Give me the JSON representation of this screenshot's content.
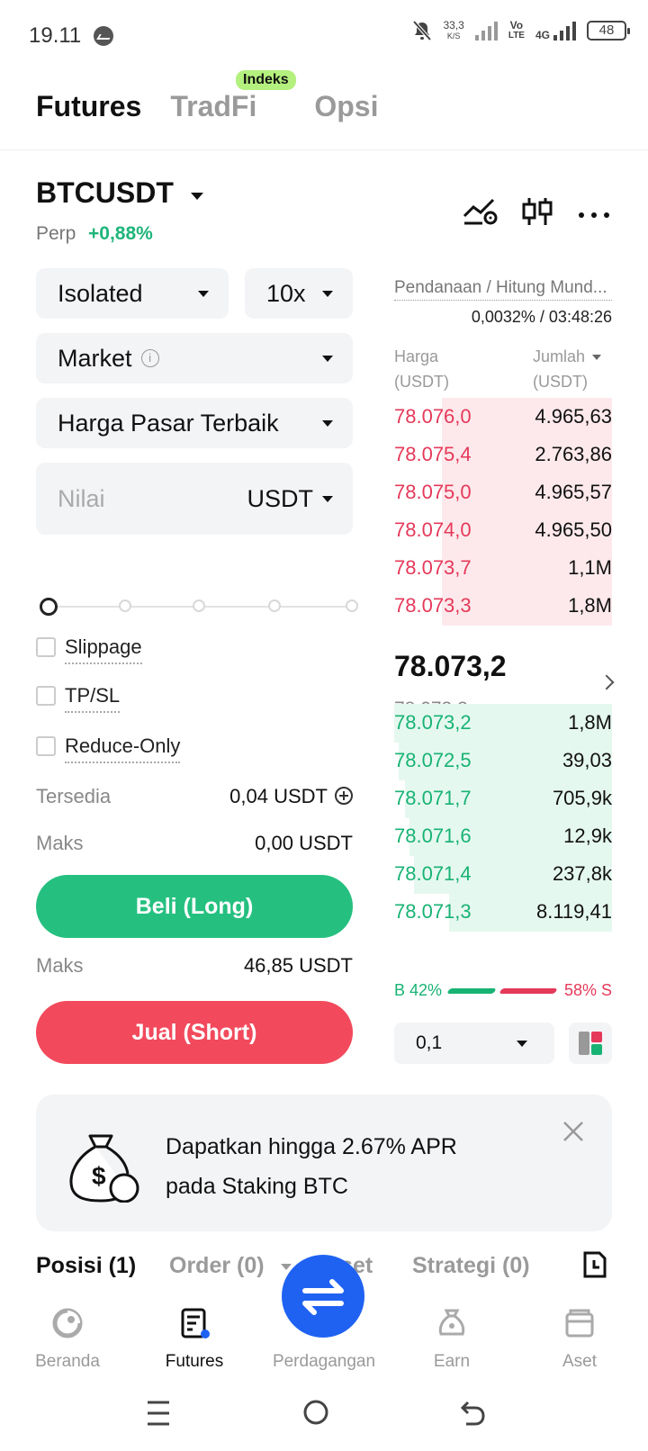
{
  "status_bar": {
    "time": "19.11",
    "speed_value": "33,3",
    "speed_unit": "K/S",
    "lte_top": "Vo",
    "lte_bottom": "LTE",
    "net": "4G",
    "battery": "48"
  },
  "top_tabs": [
    {
      "label": "Futures",
      "active": true
    },
    {
      "label": "TradFi",
      "active": false
    },
    {
      "label": "Opsi",
      "active": false
    }
  ],
  "indeks_badge": "Indeks",
  "pair": {
    "symbol": "BTCUSDT",
    "type": "Perp",
    "change": "+0,88%"
  },
  "form": {
    "margin_mode": "Isolated",
    "leverage": "10x",
    "order_type": "Market",
    "price_mode": "Harga Pasar Terbaik",
    "value_placeholder": "Nilai",
    "value_unit": "USDT",
    "slider_percent": 0,
    "checkboxes": [
      {
        "label": "Slippage",
        "checked": false
      },
      {
        "label": "TP/SL",
        "checked": false
      },
      {
        "label": "Reduce-Only",
        "checked": false
      }
    ],
    "available_label": "Tersedia",
    "available_value": "0,04 USDT",
    "max_buy_label": "Maks",
    "max_buy_value": "0,00 USDT",
    "buy_label": "Beli (Long)",
    "max_sell_label": "Maks",
    "max_sell_value": "46,85 USDT",
    "sell_label": "Jual (Short)"
  },
  "orderbook": {
    "funding_label": "Pendanaan / Hitung Mund...",
    "funding_value": "0,0032% / 03:48:26",
    "price_header": "Harga",
    "price_unit": "(USDT)",
    "qty_header": "Jumlah",
    "qty_unit": "(USDT)",
    "asks": [
      {
        "price": "78.076,0",
        "qty": "4.965,63",
        "depth": 0.78
      },
      {
        "price": "78.075,4",
        "qty": "2.763,86",
        "depth": 0.78
      },
      {
        "price": "78.075,0",
        "qty": "4.965,57",
        "depth": 0.78
      },
      {
        "price": "78.074,0",
        "qty": "4.965,50",
        "depth": 0.78
      },
      {
        "price": "78.073,7",
        "qty": "1,1M",
        "depth": 0.78
      },
      {
        "price": "78.073,3",
        "qty": "1,8M",
        "depth": 0.78
      }
    ],
    "last_price": "78.073,2",
    "mark_price": "78.073,2",
    "bids": [
      {
        "price": "78.073,2",
        "qty": "1,8M",
        "depth": 1.0
      },
      {
        "price": "78.072,5",
        "qty": "39,03",
        "depth": 0.98
      },
      {
        "price": "78.071,7",
        "qty": "705,9k",
        "depth": 0.95
      },
      {
        "price": "78.071,6",
        "qty": "12,9k",
        "depth": 0.93
      },
      {
        "price": "78.071,4",
        "qty": "237,8k",
        "depth": 0.91
      },
      {
        "price": "78.071,3",
        "qty": "8.119,41",
        "depth": 0.75
      }
    ],
    "buy_ratio": "B 42%",
    "sell_ratio": "58% S",
    "precision": "0,1"
  },
  "banner": {
    "line1": "Dapatkan hingga 2.67% APR",
    "line2": "pada Staking BTC"
  },
  "position_tabs": {
    "positions": "Posisi (1)",
    "orders": "Order (0)",
    "assets": "Aset",
    "strategy": "Strategi (0)"
  },
  "bottom_nav": [
    {
      "label": "Beranda",
      "active": false
    },
    {
      "label": "Futures",
      "active": true
    },
    {
      "label": "Perdagangan",
      "active": false
    },
    {
      "label": "Earn",
      "active": false
    },
    {
      "label": "Aset",
      "active": false
    }
  ],
  "colors": {
    "buy": "#25c080",
    "sell": "#f24a5c",
    "accent": "#1f62f2",
    "badge": "#b4f07e"
  }
}
